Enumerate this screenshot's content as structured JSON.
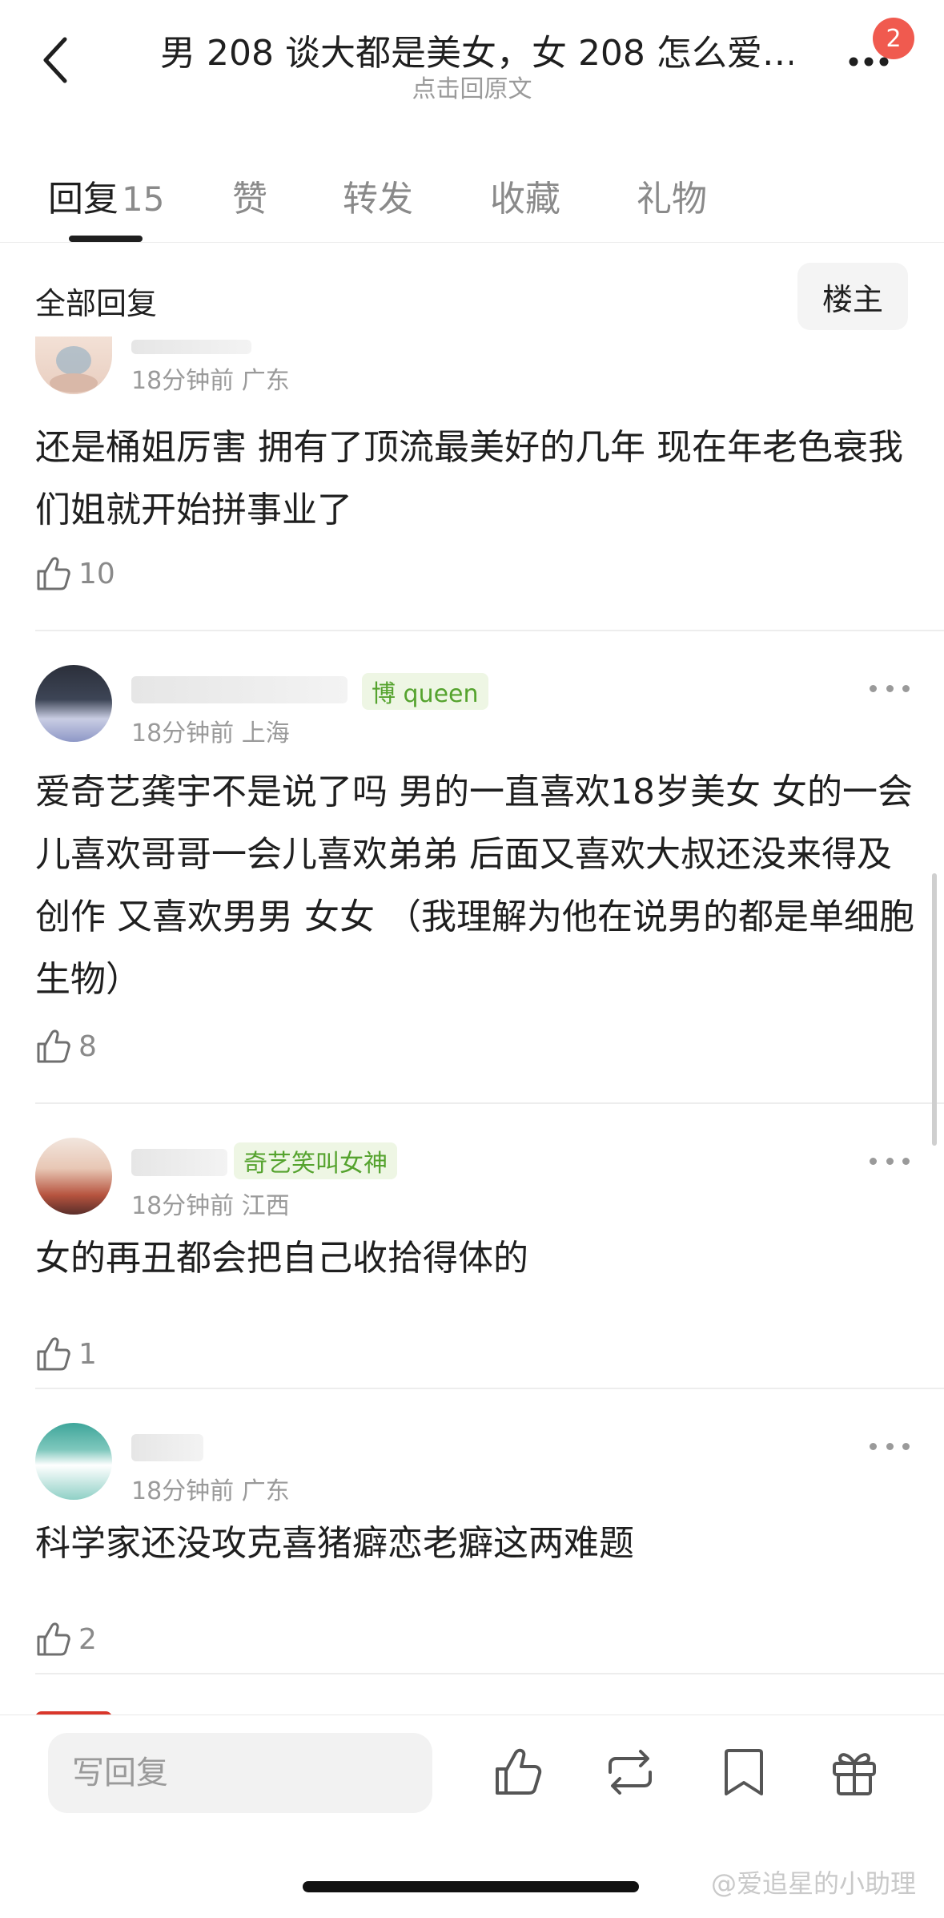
{
  "header": {
    "title": "男 208 谈大都是美女，女 208 怎么爱…",
    "subtitle": "点击回原文",
    "notification_count": "2"
  },
  "tabs": [
    {
      "label": "回复",
      "count": "15",
      "active": true
    },
    {
      "label": "赞"
    },
    {
      "label": "转发"
    },
    {
      "label": "收藏"
    },
    {
      "label": "礼物"
    }
  ],
  "filter": {
    "all_label": "全部回复",
    "op_label": "楼主"
  },
  "comments": [
    {
      "meta": "18分钟前 广东",
      "text": "还是桶姐厉害 拥有了顶流最美好的几年 现在年老色衰我们姐就开始拼事业了",
      "likes": "10"
    },
    {
      "badge": "博 queen",
      "meta": "18分钟前 上海",
      "text": "爱奇艺龚宇不是说了吗 男的一直喜欢18岁美女  女的一会儿喜欢哥哥一会儿喜欢弟弟 后面又喜欢大叔还没来得及创作 又喜欢男男 女女  （我理解为他在说男的都是单细胞生物）",
      "likes": "8"
    },
    {
      "badge": "奇艺笑叫女神",
      "meta": "18分钟前 江西",
      "text": "女的再丑都会把自己收拾得体的",
      "likes": "1"
    },
    {
      "meta": "18分钟前 广东",
      "text": "科学家还没攻克喜猪癖恋老癖这两难题",
      "likes": "2"
    }
  ],
  "bottom_bar": {
    "reply_placeholder": "写回复"
  },
  "watermark": "@爱追星的小助理",
  "icons": {
    "back": "chevron-left-icon",
    "more": "more-dots-icon",
    "like": "thumbs-up-icon",
    "repost": "repost-icon",
    "bookmark": "bookmark-icon",
    "gift": "gift-icon"
  },
  "colors": {
    "accent_red": "#f05a4f",
    "badge_green": "#55a32e"
  }
}
